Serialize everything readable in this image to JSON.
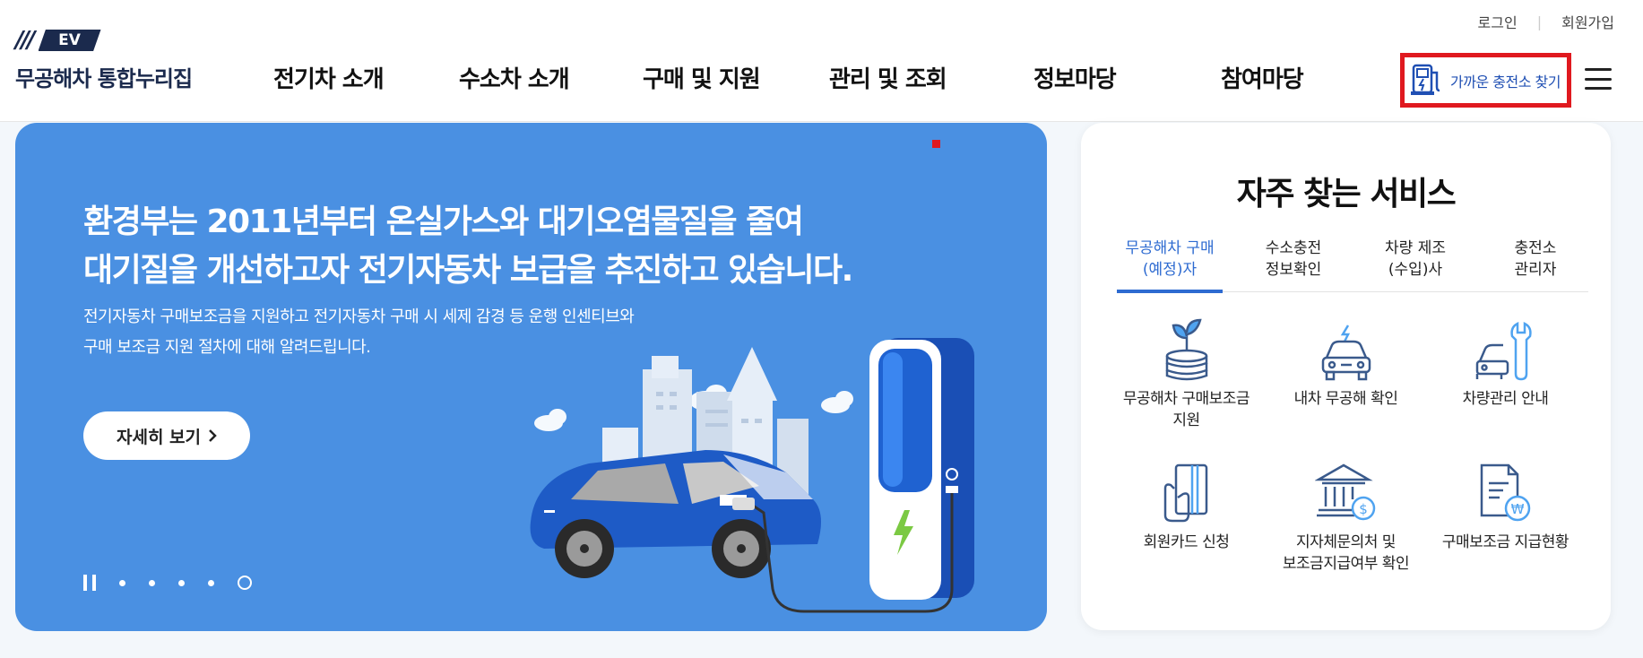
{
  "header": {
    "util": {
      "login": "로그인",
      "signup": "회원가입"
    },
    "logo": {
      "mark": "EV",
      "text": "무공해차 통합누리집"
    },
    "nav": [
      "전기차 소개",
      "수소차 소개",
      "구매 및 지원",
      "관리 및 조회",
      "정보마당",
      "참여마당"
    ],
    "charger_button": {
      "label": "가까운 충전소 찾기",
      "icon": "ev-charger-icon",
      "highlight_color": "#e0191f"
    },
    "menu_icon": "hamburger-menu-icon"
  },
  "hero": {
    "headline_1": "환경부는 2011년부터 온실가스와 대기오염물질을 줄여",
    "headline_2": "대기질을 개선하고자 전기자동차 보급을 추진하고 있습니다.",
    "sub_1": "전기자동차 구매보조금을 지원하고 전기자동차 구매 시 세제 감경 등 운행 인센티브와",
    "sub_2": "구매 보조금 지원 절차에 대해 알려드립니다.",
    "more_button": "자세히 보기",
    "background_color": "#4a90e2",
    "slides_total": 5,
    "active_slide": 5
  },
  "services": {
    "title": "자주 찾는 서비스",
    "tabs": [
      {
        "line1": "무공해차 구매",
        "line2": "(예정)자",
        "active": true
      },
      {
        "line1": "수소충전",
        "line2": "정보확인",
        "active": false
      },
      {
        "line1": "차량 제조",
        "line2": "(수입)사",
        "active": false
      },
      {
        "line1": "충전소",
        "line2": "관리자",
        "active": false
      }
    ],
    "items": [
      {
        "line1": "무공해차 구매보조금",
        "line2": "지원",
        "icon": "subsidy-coins-plant-icon"
      },
      {
        "line1": "내차 무공해 확인",
        "line2": "",
        "icon": "ev-car-check-icon"
      },
      {
        "line1": "차량관리 안내",
        "line2": "",
        "icon": "car-wrench-icon"
      },
      {
        "line1": "회원카드 신청",
        "line2": "",
        "icon": "member-card-icon"
      },
      {
        "line1": "지자체문의처 및",
        "line2": "보조금지급여부 확인",
        "icon": "government-building-icon"
      },
      {
        "line1": "구매보조금 지급현황",
        "line2": "",
        "icon": "document-won-icon"
      }
    ],
    "accent_color": "#2e6bd1"
  }
}
